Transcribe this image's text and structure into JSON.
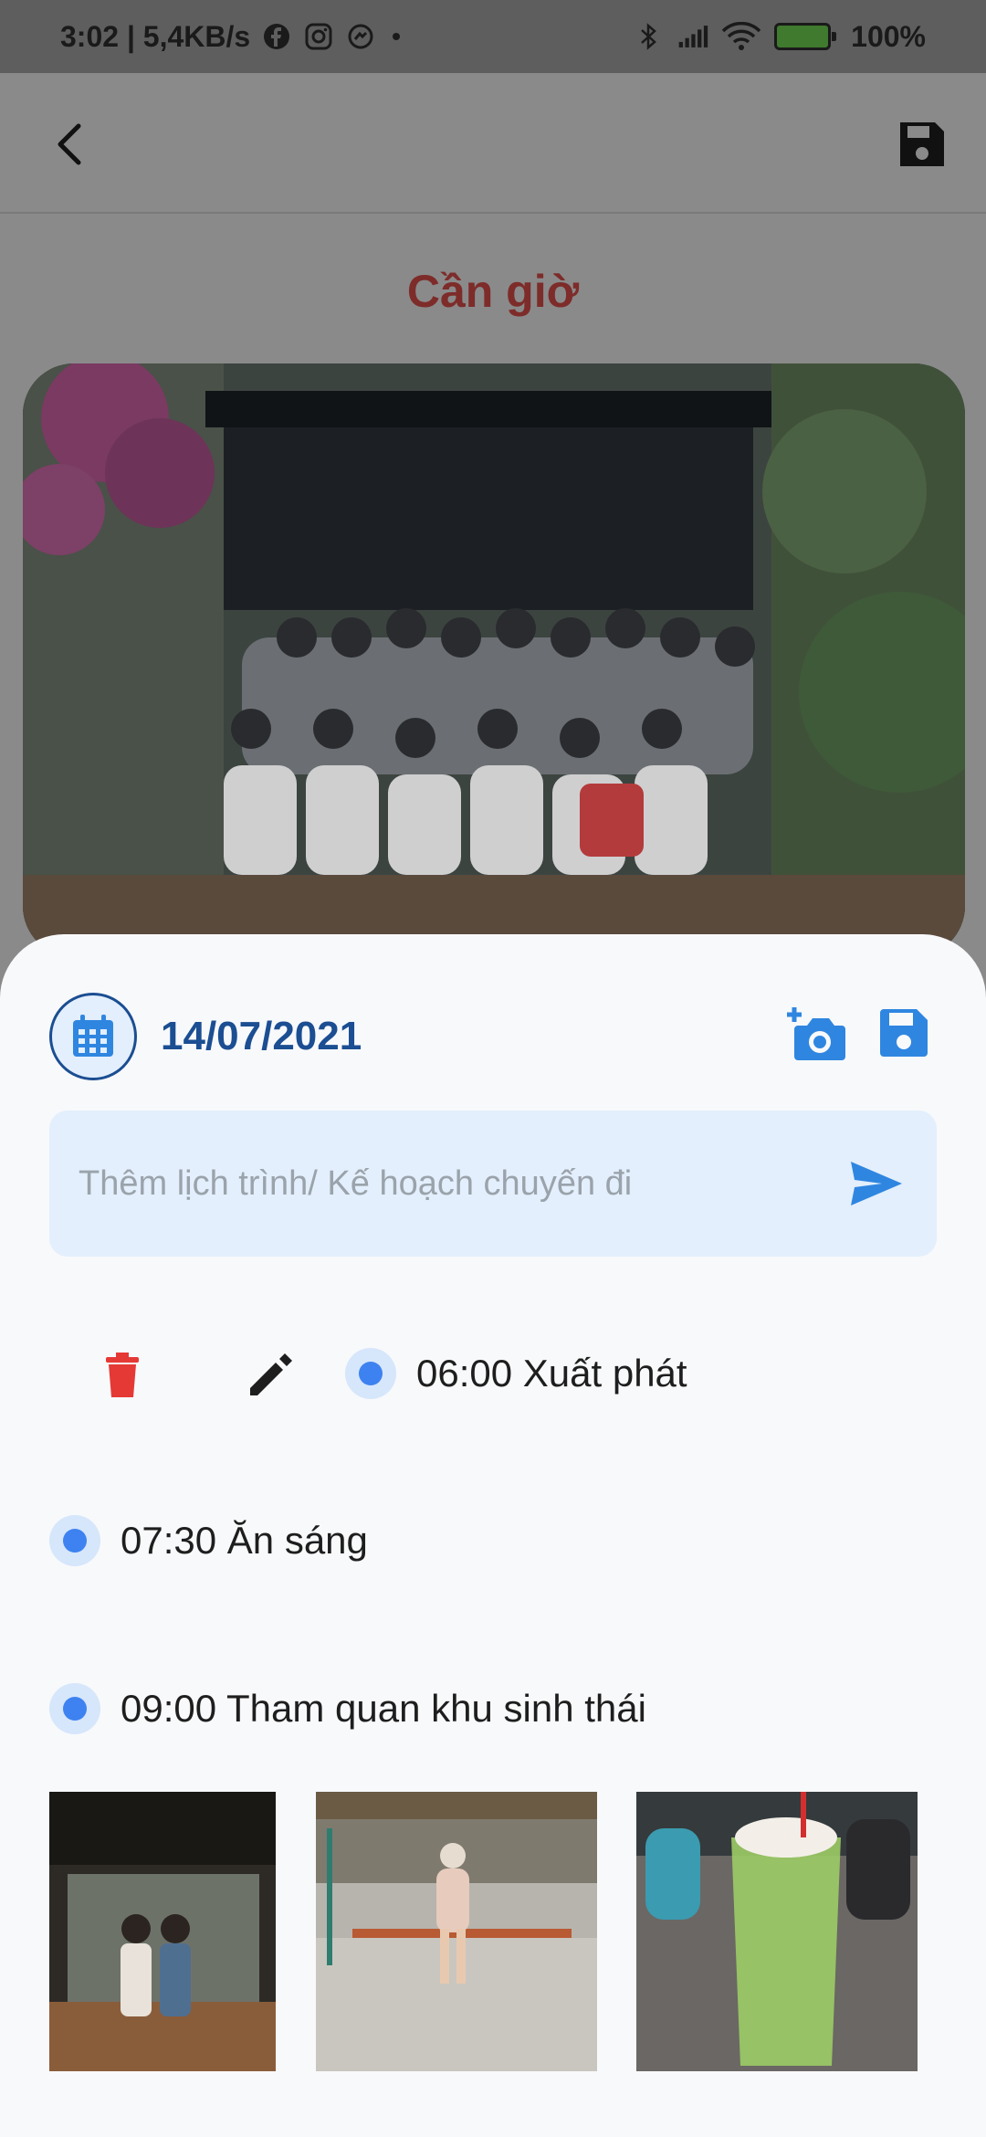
{
  "status_bar": {
    "time_speed": "3:02 | 5,4KB/s",
    "battery": "100%"
  },
  "header": {
    "title": "Cần giờ"
  },
  "sheet": {
    "date": "14/07/2021",
    "input_placeholder": "Thêm lịch trình/ Kế hoạch chuyến đi",
    "items": [
      {
        "text": "06:00 Xuất phát"
      },
      {
        "text": "07:30 Ăn sáng"
      },
      {
        "text": "09:00 Tham quan khu sinh thái"
      }
    ]
  },
  "colors": {
    "accent_blue": "#1b4e92",
    "icon_blue": "#2f86e0",
    "delete_red": "#e53935",
    "title_red": "#d9423c"
  },
  "icons": [
    "back-arrow",
    "floppy-disk",
    "calendar",
    "add-photo",
    "send",
    "trash",
    "pencil"
  ]
}
